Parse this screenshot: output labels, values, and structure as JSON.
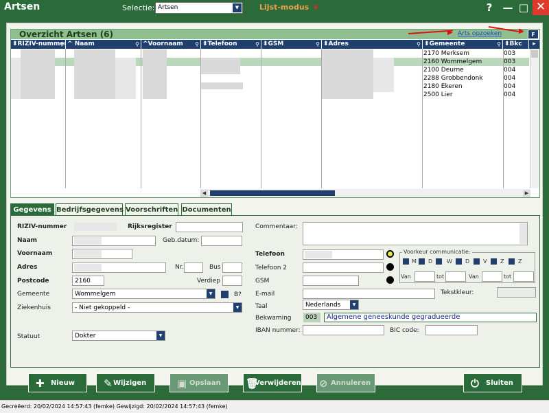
{
  "window": {
    "title": "Artsen",
    "help": "?",
    "minimize": "—",
    "maximize": "□",
    "close": "✕"
  },
  "toolbar": {
    "selectie_label": "Selectie:",
    "selectie_value": "Artsen",
    "lijst_modus": "Lijst-modus"
  },
  "grid": {
    "title": "Overzicht Artsen (6)",
    "lookup_link": "Arts opzoeken",
    "filter_button": "F",
    "columns": [
      "RIZIV-nummer",
      "Naam",
      "Voornaam",
      "Telefoon",
      "GSM",
      "Adres",
      "Gemeente",
      "Bkc"
    ],
    "rows": [
      {
        "gemeente": "2170 Merksem",
        "bkc": "003"
      },
      {
        "gemeente": "2160 Wommelgem",
        "bkc": "003"
      },
      {
        "gemeente": "2100 Deurne",
        "bkc": "004"
      },
      {
        "gemeente": "2288 Grobbendonk",
        "bkc": "004"
      },
      {
        "gemeente": "2180 Ekeren",
        "bkc": "004"
      },
      {
        "gemeente": "2500 Lier",
        "bkc": "004"
      }
    ],
    "selected_row": 1
  },
  "tabs": [
    "Gegevens",
    "Bedrijfsgegevens",
    "Voorschriften",
    "Documenten"
  ],
  "form": {
    "riziv_label": "RIZIV-nummer",
    "rijksregister_label": "Rijksregister",
    "naam_label": "Naam",
    "gebdatum_label": "Geb.datum:",
    "voornaam_label": "Voornaam",
    "adres_label": "Adres",
    "nr_label": "Nr.",
    "bus_label": "Bus",
    "postcode_label": "Postcode",
    "postcode_value": "2160",
    "verdiep_label": "Verdiep",
    "gemeente_label": "Gemeente",
    "gemeente_value": "Wommelgem",
    "b_label": "B?",
    "ziekenhuis_label": "Ziekenhuis",
    "ziekenhuis_value": "- Niet gekoppeld -",
    "statuut_label": "Statuut",
    "statuut_value": "Dokter",
    "commentaar_label": "Commentaar:",
    "telefoon_label": "Telefoon",
    "telefoon2_label": "Telefoon 2",
    "gsm_label": "GSM",
    "email_label": "E-mail",
    "tekstkleur_label": "Tekstkleur:",
    "taal_label": "Taal",
    "taal_value": "Nederlands",
    "bekwaming_label": "Bekwaming",
    "bekwaming_code": "003",
    "bekwaming_value": "Algemene geneeskunde gegradueerde",
    "iban_label": "IBAN nummer:",
    "bic_label": "BIC code:",
    "voorkeur_label": "Voorkeur communicatie:",
    "days": [
      "M",
      "D",
      "W",
      "D",
      "V",
      "Z",
      "Z"
    ],
    "van_label": "Van",
    "tot_label": "tot"
  },
  "buttons": {
    "nieuw": "Nieuw",
    "wijzigen": "Wijzigen",
    "opslaan": "Opslaan",
    "verwijderen": "Verwijderen",
    "annuleren": "Annuleren",
    "sluiten": "Sluiten"
  },
  "status": {
    "text": "Gecreëerd: 20/02/2024 14:57:43 (femke) Gewijzigd: 20/02/2024 14:57:43 (femke)"
  }
}
